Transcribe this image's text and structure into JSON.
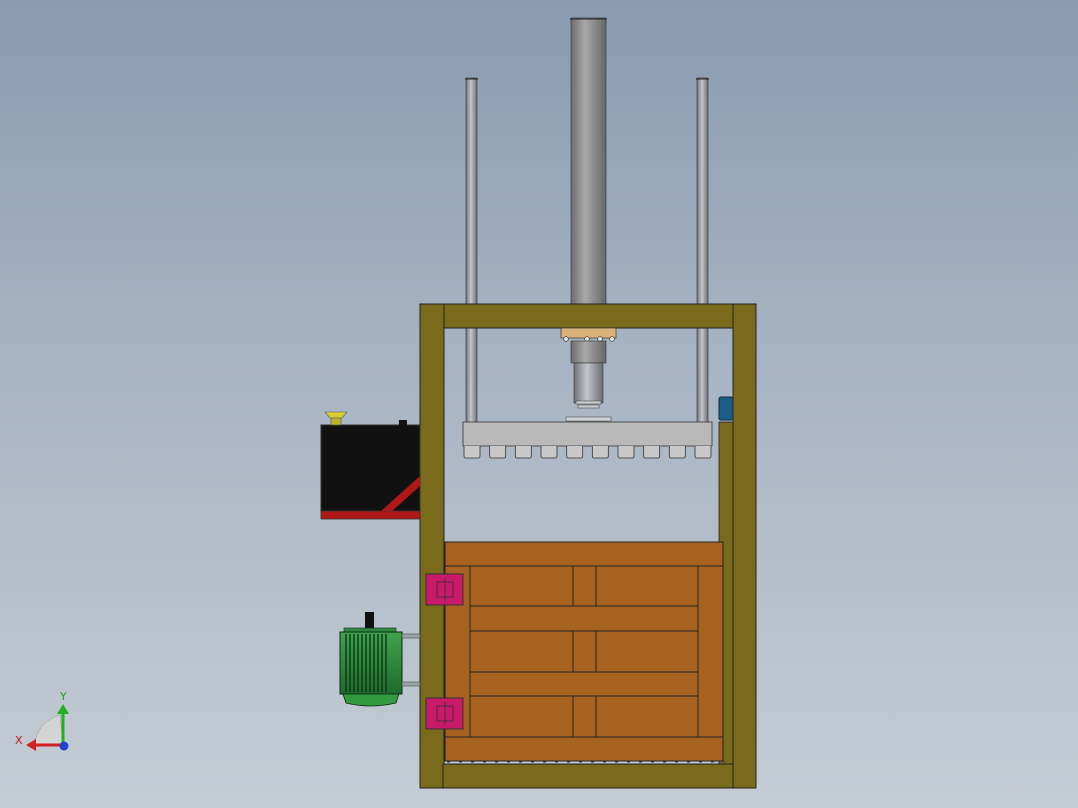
{
  "viewport": {
    "model": "vertical-baler",
    "view": "front",
    "background": "gradient-gray-blue"
  },
  "triad": {
    "x_label": "X",
    "y_label": "Y",
    "x_color": "#d02020",
    "y_color": "#20b020",
    "z_color": "#2040d0"
  },
  "colors": {
    "frame": "#7a6a1c",
    "door": "#a8621f",
    "hinge": "#c8196a",
    "motor": "#2d8a3a",
    "tank": "#111111",
    "tank_trim": "#b01818",
    "cylinder": "#8c8c8c",
    "platen": "#b9b9b9",
    "flange": "#d9b377",
    "sensor": "#1a5d8a",
    "filler_cap": "#d8d030"
  },
  "platen": {
    "tooth_count": 10
  }
}
